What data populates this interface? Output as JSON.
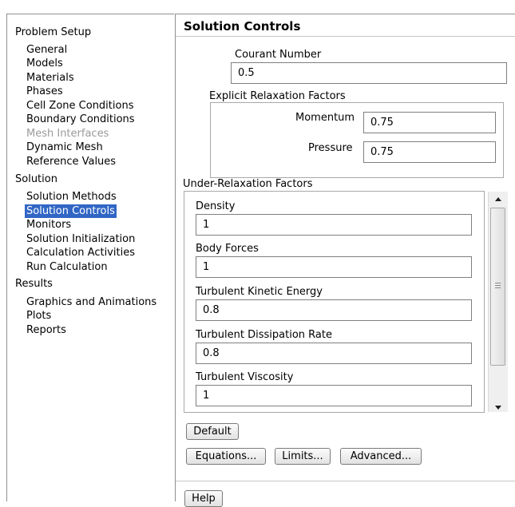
{
  "tree": {
    "sections": [
      {
        "label": "Problem Setup",
        "items": [
          {
            "label": "General",
            "state": "normal"
          },
          {
            "label": "Models",
            "state": "normal"
          },
          {
            "label": "Materials",
            "state": "normal"
          },
          {
            "label": "Phases",
            "state": "normal"
          },
          {
            "label": "Cell Zone Conditions",
            "state": "normal"
          },
          {
            "label": "Boundary Conditions",
            "state": "normal"
          },
          {
            "label": "Mesh Interfaces",
            "state": "disabled"
          },
          {
            "label": "Dynamic Mesh",
            "state": "normal"
          },
          {
            "label": "Reference Values",
            "state": "normal"
          }
        ]
      },
      {
        "label": "Solution",
        "items": [
          {
            "label": "Solution Methods",
            "state": "normal"
          },
          {
            "label": "Solution Controls",
            "state": "selected"
          },
          {
            "label": "Monitors",
            "state": "normal"
          },
          {
            "label": "Solution Initialization",
            "state": "normal"
          },
          {
            "label": "Calculation Activities",
            "state": "normal"
          },
          {
            "label": "Run Calculation",
            "state": "normal"
          }
        ]
      },
      {
        "label": "Results",
        "items": [
          {
            "label": "Graphics and Animations",
            "state": "normal"
          },
          {
            "label": "Plots",
            "state": "normal"
          },
          {
            "label": "Reports",
            "state": "normal"
          }
        ]
      }
    ]
  },
  "panel": {
    "title": "Solution Controls",
    "courant": {
      "label": "Courant Number",
      "value": "0.5"
    },
    "explicit": {
      "title": "Explicit Relaxation Factors",
      "momentum": {
        "label": "Momentum",
        "value": "0.75"
      },
      "pressure": {
        "label": "Pressure",
        "value": "0.75"
      }
    },
    "under_relaxation": {
      "title": "Under-Relaxation Factors",
      "fields": [
        {
          "label": "Density",
          "value": "1"
        },
        {
          "label": "Body Forces",
          "value": "1"
        },
        {
          "label": "Turbulent Kinetic Energy",
          "value": "0.8"
        },
        {
          "label": "Turbulent Dissipation Rate",
          "value": "0.8"
        },
        {
          "label": "Turbulent Viscosity",
          "value": "1"
        }
      ]
    },
    "buttons": {
      "default": "Default",
      "equations": "Equations...",
      "limits": "Limits...",
      "advanced": "Advanced...",
      "help": "Help"
    }
  },
  "icons": {
    "scroll_up": "scroll-up-arrow-icon",
    "scroll_down": "scroll-down-arrow-icon",
    "scroll_grip": "scroll-grip-icon"
  },
  "colors": {
    "selection": "#3166c5",
    "disabled_text": "#9a9a9a",
    "border": "#8f8f8f"
  }
}
